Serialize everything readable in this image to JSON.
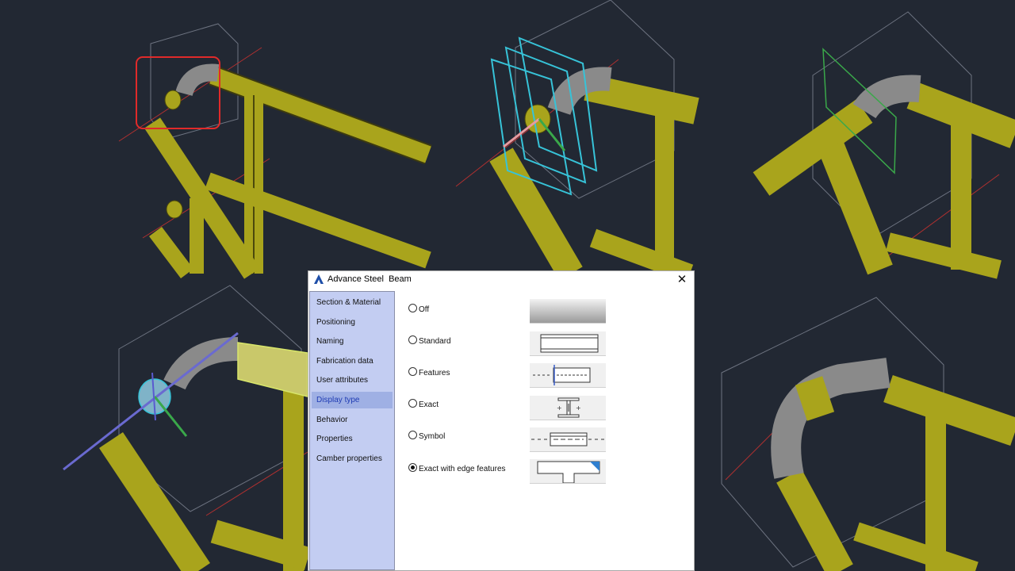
{
  "dialog": {
    "app_name": "Advance Steel",
    "object_name": "Beam",
    "close_glyph": "✕"
  },
  "sidebar": {
    "items": [
      {
        "label": "Section & Material"
      },
      {
        "label": "Positioning"
      },
      {
        "label": "Naming"
      },
      {
        "label": "Fabrication data"
      },
      {
        "label": "User attributes"
      },
      {
        "label": "Display type",
        "selected": true
      },
      {
        "label": "Behavior"
      },
      {
        "label": "Properties"
      },
      {
        "label": "Camber properties"
      }
    ]
  },
  "display_type": {
    "options": [
      {
        "label": "Off",
        "checked": false
      },
      {
        "label": "Standard",
        "checked": false
      },
      {
        "label": "Features",
        "checked": false
      },
      {
        "label": "Exact",
        "checked": false
      },
      {
        "label": "Symbol",
        "checked": false
      },
      {
        "label": "Exact with edge features",
        "checked": true
      }
    ]
  },
  "colors": {
    "viewport_bg": "#222833",
    "steel": "#a9a41c",
    "sidebar_bg": "#c3cdf2",
    "selected_text": "#1f3bb3",
    "highlight_red": "#e02a2a"
  },
  "icons": [
    "advance-steel-logo-icon",
    "close-icon"
  ]
}
